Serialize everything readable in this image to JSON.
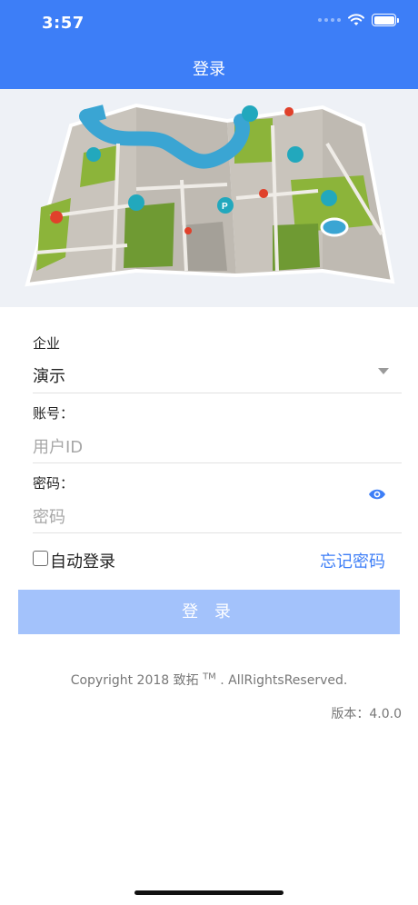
{
  "status_bar": {
    "time": "3:57"
  },
  "nav": {
    "title": "登录"
  },
  "form": {
    "company_label": "企业",
    "company_value": "演示",
    "account_label": "账号：",
    "account_placeholder": "用户ID",
    "password_label": "密码：",
    "password_placeholder": "密码",
    "auto_login_label": "自动登录",
    "forgot_password": "忘记密码",
    "login_button": "登 录"
  },
  "footer": {
    "copyright_prefix": "Copyright 2018 致拓 ",
    "trademark": "TM",
    "copyright_suffix": " . AllRightsReserved.",
    "version_label": "版本：",
    "version_value": "4.0.0"
  },
  "colors": {
    "primary": "#3d7ef7",
    "button_disabled": "#a3c2fb",
    "link": "#3d7ef7"
  }
}
